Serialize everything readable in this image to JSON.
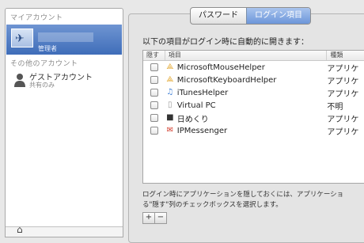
{
  "sidebar": {
    "my_account_header": "マイアカウント",
    "current_user": {
      "role": "管理者"
    },
    "other_accounts_header": "その他のアカウント",
    "guest": {
      "name": "ゲストアカウント",
      "status": "共有のみ"
    }
  },
  "tabs": [
    {
      "label": "パスワード",
      "active": false
    },
    {
      "label": "ログイン項目",
      "active": true
    }
  ],
  "intro": "以下の項目がログイン時に自動的に開きます：",
  "table": {
    "headers": {
      "hide": "隠す",
      "item": "項目",
      "kind": "種類"
    },
    "rows": [
      {
        "icon": "mouse-helper-icon",
        "name": "MicrosoftMouseHelper",
        "kind": "アプリケ"
      },
      {
        "icon": "keyboard-helper-icon",
        "name": "MicrosoftKeyboardHelper",
        "kind": "アプリケ"
      },
      {
        "icon": "itunes-helper-icon",
        "name": "iTunesHelper",
        "kind": "アプリケ"
      },
      {
        "icon": "document-icon",
        "name": "Virtual PC",
        "kind": "不明"
      },
      {
        "icon": "calendar-icon",
        "name": "日めくり",
        "kind": "アプリケ"
      },
      {
        "icon": "ipmessenger-icon",
        "name": "IPMessenger",
        "kind": "アプリケ"
      }
    ]
  },
  "footnote": {
    "line1": "ログイン時にアプリケーションを隠しておくには、アプリケーショ",
    "line2": "る\"隠す\"列のチェックボックスを選択します。"
  },
  "buttons": {
    "add": "+",
    "remove": "−"
  }
}
